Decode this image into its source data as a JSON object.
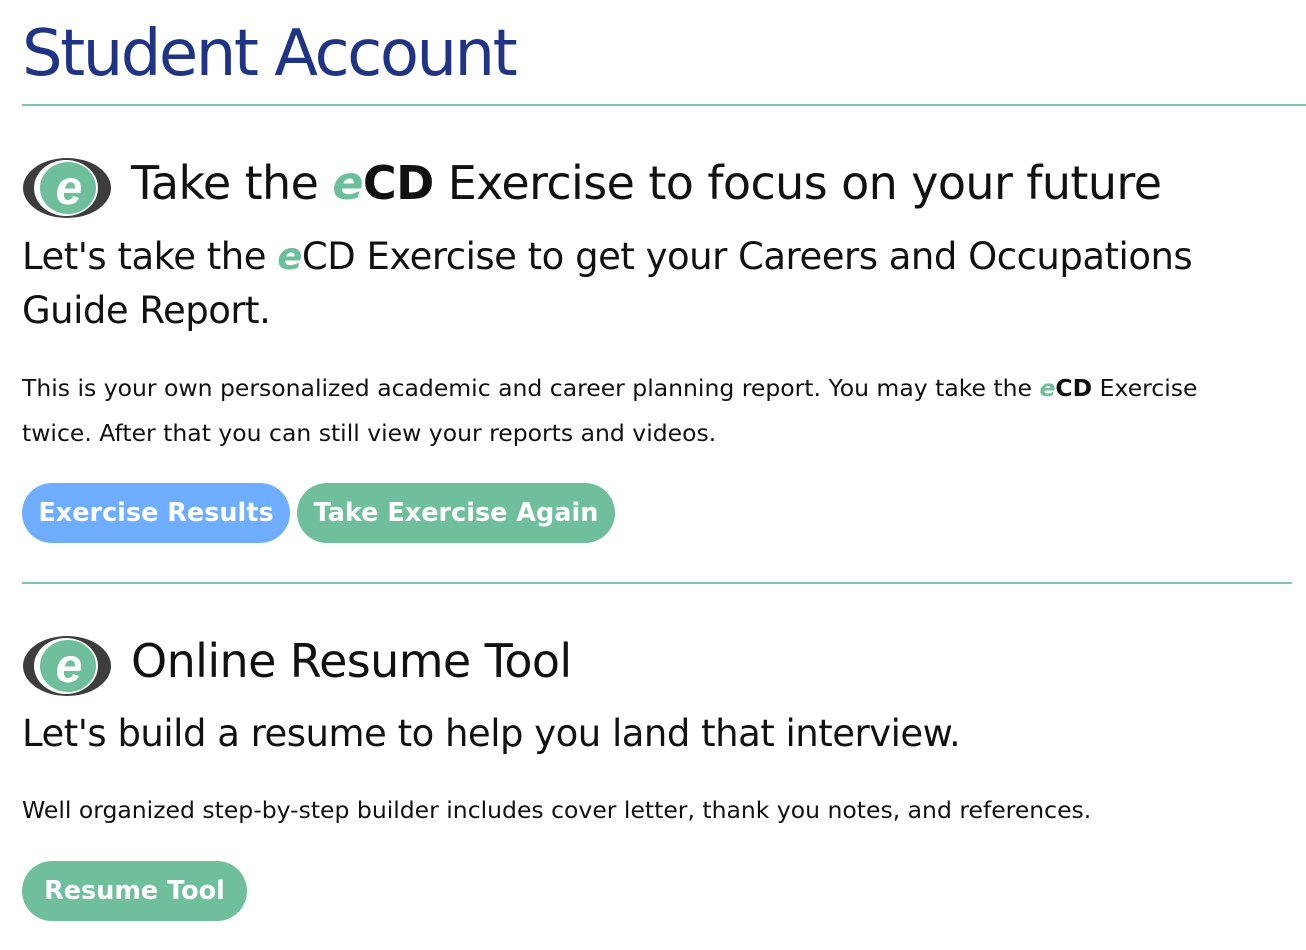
{
  "page": {
    "title": "Student Account"
  },
  "colors": {
    "title": "#1f3485",
    "divider": "#7cc3b8",
    "accent_green": "#6dbf9c",
    "button_blue": "#6eadff",
    "button_green": "#6fbf9c"
  },
  "ecd_section": {
    "logo_icon": "ecd-e-logo-icon",
    "heading_prefix": "Take the ",
    "heading_e": "e",
    "heading_cd": "CD",
    "heading_suffix": " Exercise to focus on your future",
    "lead_prefix": "Let's take the ",
    "lead_e": "e",
    "lead_cd": "CD",
    "lead_suffix": " Exercise to get your Careers and Occupations Guide Report.",
    "body_prefix": "This is your own personalized academic and career planning report. You may take the ",
    "body_e": "e",
    "body_cd": "CD",
    "body_suffix": " Exercise twice. After that you can still view your reports and videos.",
    "results_button": "Exercise Results",
    "again_button": "Take Exercise Again"
  },
  "resume_section": {
    "logo_icon": "ecd-e-logo-icon",
    "heading": "Online Resume Tool",
    "lead": "Let's build a resume to help you land that interview.",
    "body": "Well organized step-by-step builder includes cover letter, thank you notes, and references.",
    "button": "Resume Tool"
  }
}
